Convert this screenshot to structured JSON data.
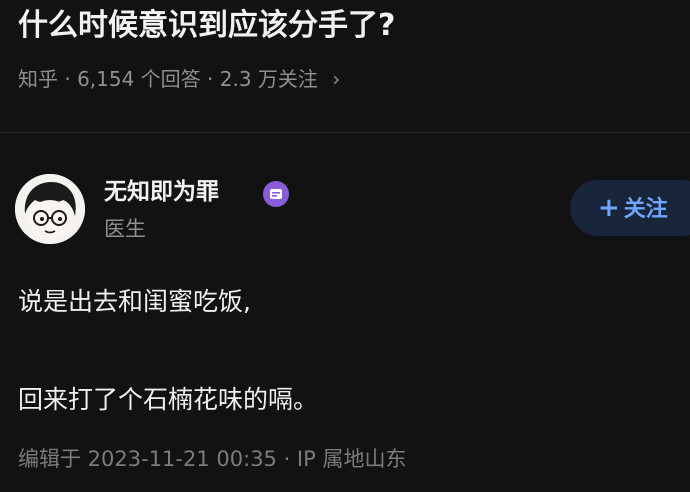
{
  "question": {
    "title": "什么时候意识到应该分手了?",
    "meta": "知乎 · 6,154 个回答 · 2.3 万关注",
    "meta_chevron": "›"
  },
  "author": {
    "name": "无知即为罪",
    "role": "医生",
    "badge_color": "#8a5cd8"
  },
  "follow_button": {
    "plus": "+",
    "label": "关注",
    "color": "#6fa6ff"
  },
  "answer": {
    "lines": [
      "说是出去和闺蜜吃饭,",
      "回来打了个石楠花味的嗝。"
    ],
    "edit_info": "编辑于 2023-11-21 00:35 · IP 属地山东"
  },
  "colors": {
    "background": "#121212",
    "muted_text": "#8e8e93"
  }
}
